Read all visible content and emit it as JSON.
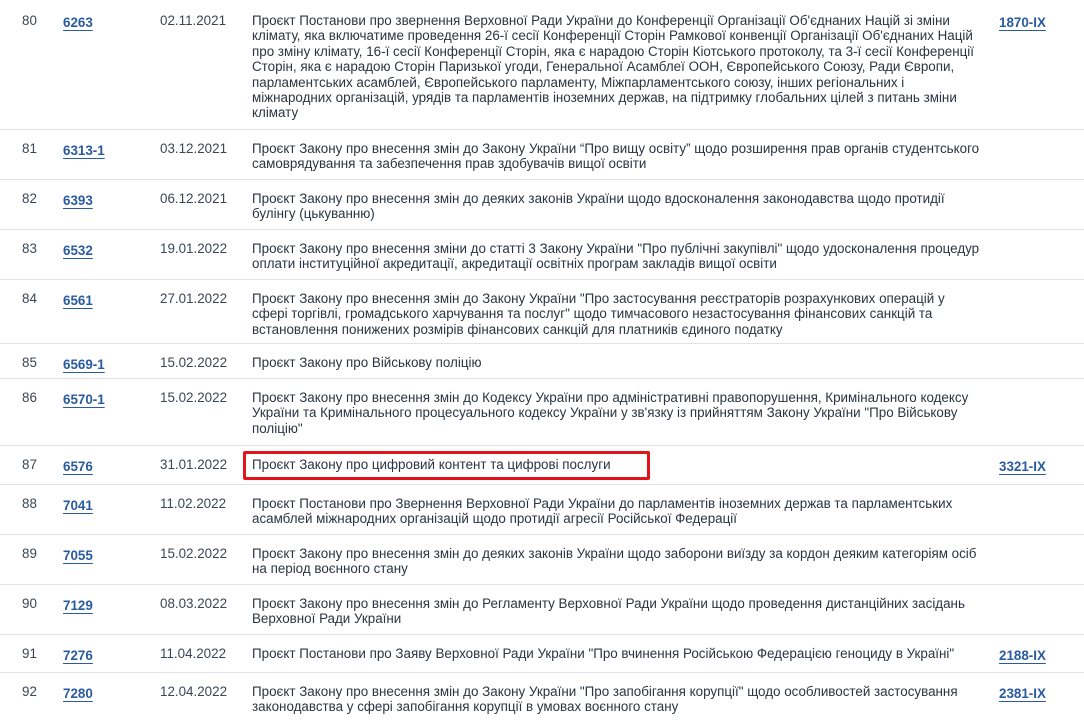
{
  "rows": [
    {
      "num": "80",
      "reg": "6263",
      "date": "02.11.2021",
      "title": "Проєкт Постанови про звернення Верховної Ради України до Конференції Організації Об'єднаних Націй зі зміни клімату, яка включатиме проведення 26-ї сесії Конференції Сторін Рамкової конвенції Організації Об'єднаних Націй про зміну клімату, 16-ї сесії Конференції Сторін, яка є нарадою Сторін Кіотського протоколу, та 3-ї сесії Конференції Сторін, яка є нарадою Сторін Паризької угоди, Генеральної Асамблеї ООН, Європейського Союзу, Ради Європи, парламентських асамблей, Європейського парламенту, Міжпарламентського союзу, інших регіональних і міжнародних організацій, урядів та парламентів іноземних держав, на підтримку глобальних цілей з питань зміни клімату",
      "law": "1870-IX"
    },
    {
      "num": "81",
      "reg": "6313-1",
      "date": "03.12.2021",
      "title": "Проєкт Закону про внесення змін до Закону України “Про вищу освіту” щодо розширення прав органів студентського самоврядування та забезпечення прав здобувачів вищої освіти",
      "law": ""
    },
    {
      "num": "82",
      "reg": "6393",
      "date": "06.12.2021",
      "title": "Проєкт Закону про внесення змін до деяких законів України щодо вдосконалення законодавства щодо протидії булінгу (цькуванню)",
      "law": ""
    },
    {
      "num": "83",
      "reg": "6532",
      "date": "19.01.2022",
      "title": "Проєкт Закону про внесення зміни до статті 3 Закону України \"Про публічні закупівлі\" щодо удосконалення процедур оплати інституційної акредитації, акредитації освітніх програм закладів вищої освіти",
      "law": ""
    },
    {
      "num": "84",
      "reg": "6561",
      "date": "27.01.2022",
      "title": "Проєкт Закону про внесення змін до Закону України \"Про застосування реєстраторів розрахункових операцій у сфері торгівлі, громадського харчування та послуг\" щодо тимчасового незастосування фінансових санкцій та встановлення понижених розмірів фінансових санкцій для платників єдиного податку",
      "law": ""
    },
    {
      "num": "85",
      "reg": "6569-1",
      "date": "15.02.2022",
      "title": "Проєкт Закону про Військову поліцію",
      "law": ""
    },
    {
      "num": "86",
      "reg": "6570-1",
      "date": "15.02.2022",
      "title": "Проєкт Закону про внесення змін до Кодексу України про адміністративні правопорушення, Кримінального кодексу України та Кримінального процесуального кодексу України у зв'язку із прийняттям Закону України \"Про Військову поліцію\"",
      "law": ""
    },
    {
      "num": "87",
      "reg": "6576",
      "date": "31.01.2022",
      "title": "Проєкт Закону про цифровий контент та цифрові послуги",
      "law": "3321-IX"
    },
    {
      "num": "88",
      "reg": "7041",
      "date": "11.02.2022",
      "title": "Проєкт Постанови про Звернення Верховної Ради України до парламентів іноземних держав та парламентських асамблей міжнародних організацій щодо протидії агресії Російської Федерації",
      "law": ""
    },
    {
      "num": "89",
      "reg": "7055",
      "date": "15.02.2022",
      "title": "Проєкт Закону про внесення змін до деяких законів України щодо заборони виїзду за кордон деяким категоріям осіб на період воєнного стану",
      "law": ""
    },
    {
      "num": "90",
      "reg": "7129",
      "date": "08.03.2022",
      "title": "Проєкт Закону про внесення змін до Регламенту Верховної Ради України щодо проведення дистанційних засідань Верховної Ради України",
      "law": ""
    },
    {
      "num": "91",
      "reg": "7276",
      "date": "11.04.2022",
      "title": "Проєкт Постанови про Заяву Верховної Ради України \"Про вчинення Російською Федерацією геноциду в Україні\"",
      "law": "2188-IX"
    },
    {
      "num": "92",
      "reg": "7280",
      "date": "12.04.2022",
      "title": "Проєкт Закону про внесення змін до Закону України \"Про запобігання корупції\" щодо особливостей застосування законодавства у сфері запобігання корупції в умовах воєнного стану",
      "law": "2381-IX"
    }
  ]
}
